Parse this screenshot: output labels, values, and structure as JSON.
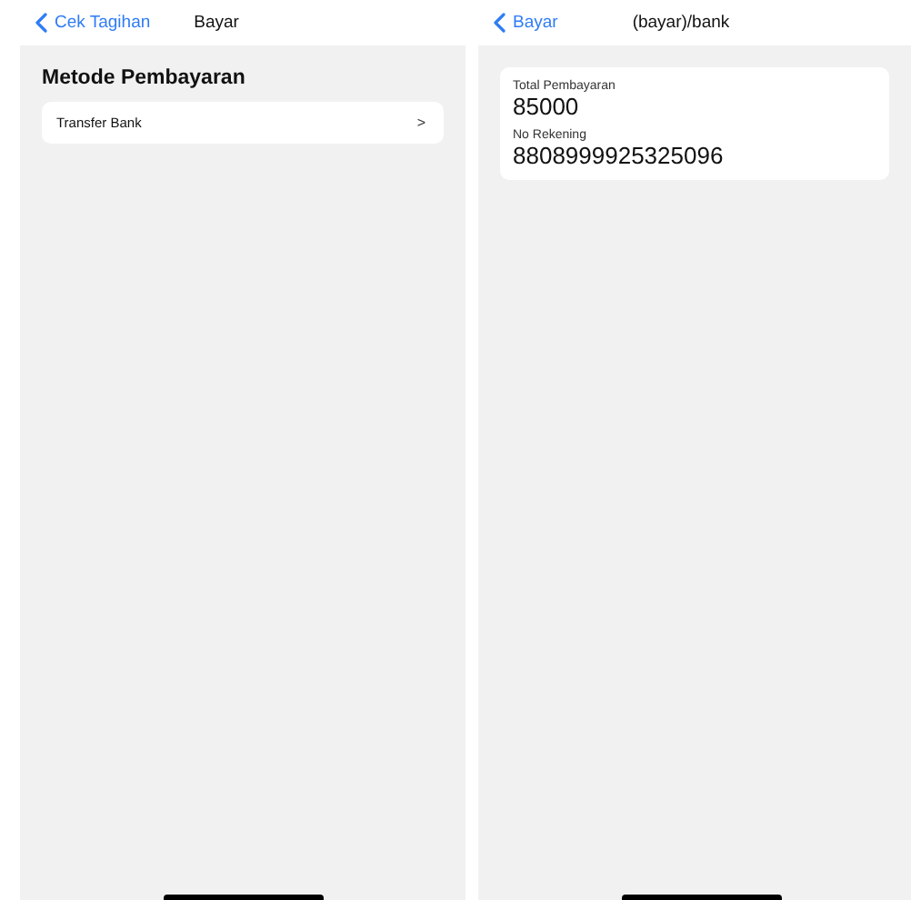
{
  "screens": [
    {
      "kind": "methods",
      "nav": {
        "back": "Cek Tagihan",
        "title": "Bayar"
      },
      "heading": "Metode Pembayaran",
      "items": [
        {
          "label": "Transfer Bank",
          "chevron": ">"
        }
      ]
    },
    {
      "kind": "detail",
      "nav": {
        "back": "Bayar",
        "title": "(bayar)/bank"
      },
      "fields": [
        {
          "label": "Total Pembayaran",
          "value": "85000"
        },
        {
          "label": "No Rekening",
          "value": "8808999925325096"
        }
      ]
    }
  ]
}
